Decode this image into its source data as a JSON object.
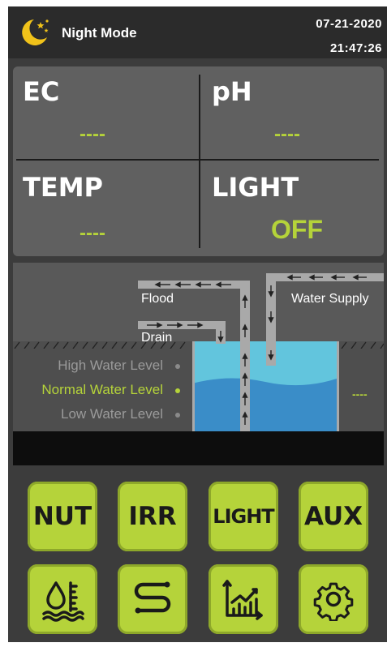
{
  "header": {
    "mode_label": "Night Mode",
    "date": "07-21-2020",
    "time": "21:47:26",
    "mode_icon": "moon-stars-icon"
  },
  "sensors": {
    "ec": {
      "label": "EC",
      "value": "----"
    },
    "ph": {
      "label": "pH",
      "value": "----"
    },
    "temp": {
      "label": "TEMP",
      "value": "----"
    },
    "light": {
      "label": "LIGHT",
      "value": "OFF"
    }
  },
  "tank": {
    "flood_label": "Flood",
    "drain_label": "Drain",
    "water_supply_label": "Water Supply",
    "levels": [
      {
        "label": "High Water Level",
        "active": false
      },
      {
        "label": "Normal Water Level",
        "active": true
      },
      {
        "label": "Low Water Level",
        "active": false
      }
    ],
    "level_value": "----"
  },
  "buttons": [
    {
      "label": "NUT",
      "icon": null
    },
    {
      "label": "IRR",
      "icon": null
    },
    {
      "label": "LIGHT",
      "icon": null
    },
    {
      "label": "AUX",
      "icon": null
    },
    {
      "label": "",
      "icon": "water-level-icon"
    },
    {
      "label": "",
      "icon": "pipe-route-icon"
    },
    {
      "label": "",
      "icon": "chart-trend-icon"
    },
    {
      "label": "",
      "icon": "gear-icon"
    }
  ],
  "colors": {
    "accent": "#b5d33a",
    "background": "#3c3c3c",
    "header": "#2b2b2b",
    "panel": "#606060",
    "water_light": "#62c5dd",
    "water_dark": "#3a8dc8"
  }
}
